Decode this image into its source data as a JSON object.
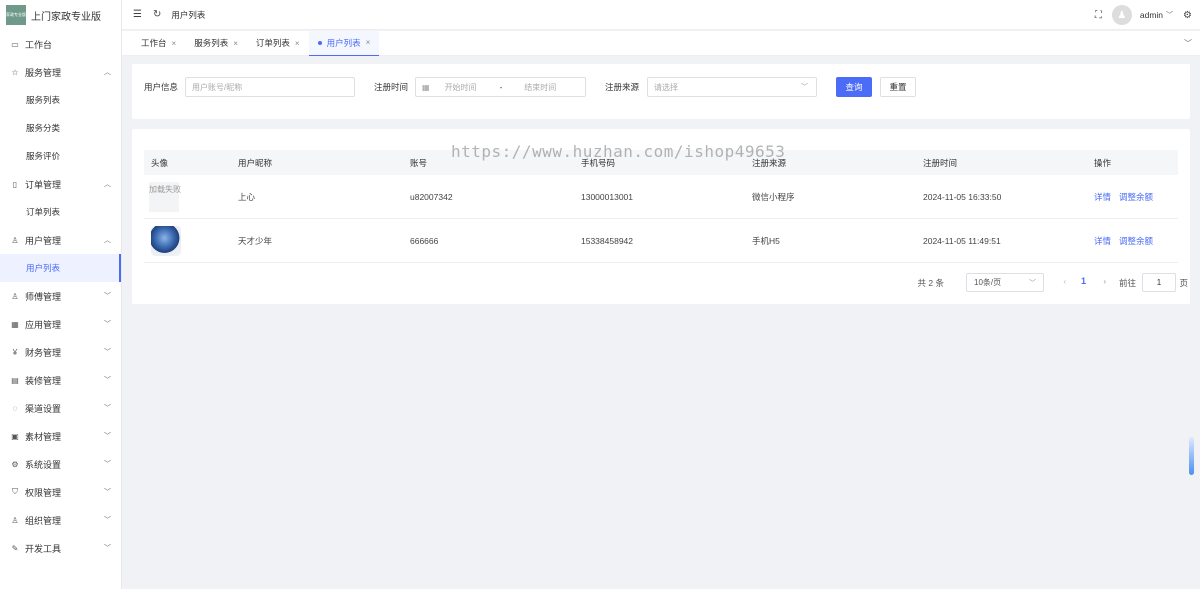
{
  "app": {
    "logo_text": "家政专业版",
    "title": "上门家政专业版"
  },
  "sidebar": {
    "items": [
      {
        "label": "工作台",
        "icon": "monitor-icon",
        "expandable": false
      },
      {
        "label": "服务管理",
        "icon": "star-icon",
        "expandable": true,
        "expanded": true,
        "children": [
          {
            "label": "服务列表"
          },
          {
            "label": "服务分类"
          },
          {
            "label": "服务评价"
          }
        ]
      },
      {
        "label": "订单管理",
        "icon": "document-icon",
        "expandable": true,
        "expanded": true,
        "children": [
          {
            "label": "订单列表"
          }
        ]
      },
      {
        "label": "用户管理",
        "icon": "user-icon",
        "expandable": true,
        "expanded": true,
        "children": [
          {
            "label": "用户列表",
            "active": true
          }
        ]
      },
      {
        "label": "师傅管理",
        "icon": "worker-icon",
        "expandable": true
      },
      {
        "label": "应用管理",
        "icon": "grid-icon",
        "expandable": true
      },
      {
        "label": "财务管理",
        "icon": "money-icon",
        "expandable": true
      },
      {
        "label": "装修管理",
        "icon": "brush-icon",
        "expandable": true
      },
      {
        "label": "渠道设置",
        "icon": "chat-icon",
        "expandable": true
      },
      {
        "label": "素材管理",
        "icon": "image-icon",
        "expandable": true
      },
      {
        "label": "系统设置",
        "icon": "gear-icon",
        "expandable": true
      },
      {
        "label": "权限管理",
        "icon": "shield-icon",
        "expandable": true
      },
      {
        "label": "组织管理",
        "icon": "person-icon",
        "expandable": true
      },
      {
        "label": "开发工具",
        "icon": "pen-icon",
        "expandable": true
      }
    ]
  },
  "header": {
    "breadcrumb": "用户列表",
    "username": "admin"
  },
  "tabs": [
    {
      "label": "工作台",
      "active": false
    },
    {
      "label": "服务列表",
      "active": false
    },
    {
      "label": "订单列表",
      "active": false
    },
    {
      "label": "用户列表",
      "active": true
    }
  ],
  "filter": {
    "user_info_label": "用户信息",
    "user_info_placeholder": "用户账号/昵称",
    "reg_time_label": "注册时间",
    "start_placeholder": "开始时间",
    "range_sep": "-",
    "end_placeholder": "结束时间",
    "source_label": "注册来源",
    "source_placeholder": "请选择",
    "query_button": "查询",
    "reset_button": "重置"
  },
  "table": {
    "columns": [
      "头像",
      "用户昵称",
      "账号",
      "手机号码",
      "注册来源",
      "注册时间",
      "操作"
    ],
    "rows": [
      {
        "avatar_text": "加载失败",
        "nickname": "上心",
        "account": "u82007342",
        "phone": "13000013001",
        "source": "微信小程序",
        "reg_time": "2024-11-05 16:33:50",
        "action_detail": "详情",
        "action_balance": "调整余额"
      },
      {
        "avatar_text": "",
        "nickname": "天才少年",
        "account": "666666",
        "phone": "15338458942",
        "source": "手机H5",
        "reg_time": "2024-11-05 11:49:51",
        "action_detail": "详情",
        "action_balance": "调整余额"
      }
    ]
  },
  "pagination": {
    "total": "共 2 条",
    "page_size": "10条/页",
    "current_page": "1",
    "goto_label": "前往",
    "goto_value": "1",
    "page_suffix": "页"
  },
  "watermark": "https://www.huzhan.com/ishop49653"
}
